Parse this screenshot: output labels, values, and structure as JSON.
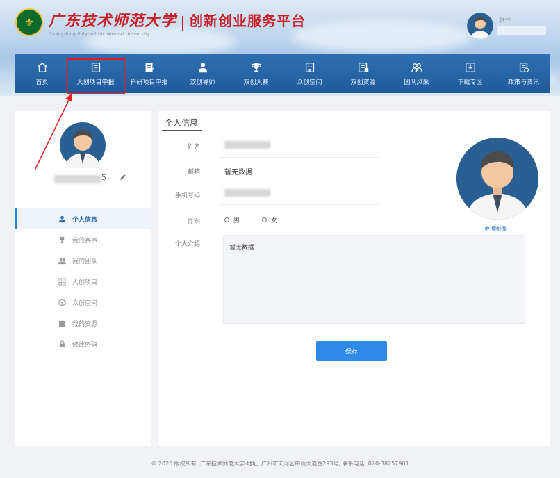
{
  "header": {
    "school_name_cn": "广东技术师范大学",
    "school_name_en": "Guangdong Polytechnic Normal University",
    "platform_title": "创新创业服务平台",
    "user_name": "张**",
    "logo_glyph": "⚜"
  },
  "nav": {
    "items": [
      {
        "label": "首页",
        "icon": "home-icon"
      },
      {
        "label": "大创项目申报",
        "icon": "document-edit-icon"
      },
      {
        "label": "科研项目申报",
        "icon": "document-check-icon"
      },
      {
        "label": "双创导师",
        "icon": "mentor-icon"
      },
      {
        "label": "双创大赛",
        "icon": "trophy-icon"
      },
      {
        "label": "众创空间",
        "icon": "building-icon"
      },
      {
        "label": "双创资源",
        "icon": "resource-icon"
      },
      {
        "label": "团队风采",
        "icon": "team-icon"
      },
      {
        "label": "下载专区",
        "icon": "download-icon"
      },
      {
        "label": "政策与资讯",
        "icon": "policy-icon"
      }
    ]
  },
  "sidebar": {
    "user_name_suffix": "5",
    "menu": [
      {
        "label": "个人信息",
        "icon": "user-icon",
        "active": true
      },
      {
        "label": "我的赛事",
        "icon": "trophy-icon",
        "active": false
      },
      {
        "label": "我的团队",
        "icon": "team-icon",
        "active": false
      },
      {
        "label": "大创项目",
        "icon": "project-icon",
        "active": false
      },
      {
        "label": "众创空间",
        "icon": "cube-icon",
        "active": false
      },
      {
        "label": "我的资源",
        "icon": "folder-icon",
        "active": false
      },
      {
        "label": "修改密码",
        "icon": "lock-icon",
        "active": false
      }
    ]
  },
  "profile": {
    "title": "个人信息",
    "name_label": "姓名:",
    "email_label": "邮箱:",
    "email_value": "暂无数据",
    "phone_label": "手机号码:",
    "gender_label": "性别:",
    "gender_male": "男",
    "gender_female": "女",
    "intro_label": "个人介绍:",
    "intro_value": "暂无数据",
    "change_avatar": "更换图像",
    "save_button": "保存"
  },
  "footer": {
    "text": "© 2020 版权所有: 广东技术师范大学-地址: 广州市天河区中山大道西293号, 联系电话: 020-38257901"
  },
  "colors": {
    "nav_bg": "#1f5b9c",
    "accent": "#2f8ae6",
    "brand_red": "#c81d25",
    "highlight": "#e02020"
  }
}
